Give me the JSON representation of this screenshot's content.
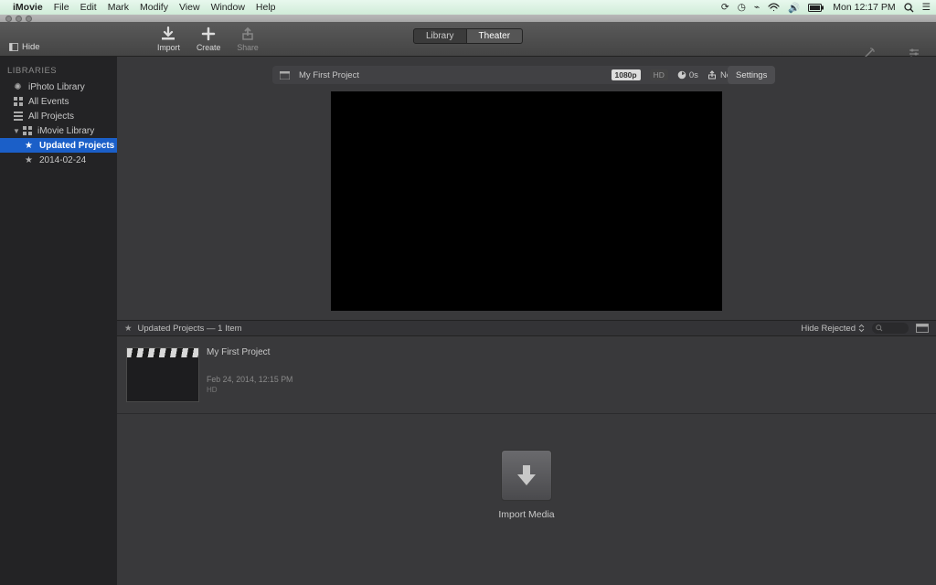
{
  "menubar": {
    "app": "iMovie",
    "items": [
      "File",
      "Edit",
      "Mark",
      "Modify",
      "View",
      "Window",
      "Help"
    ],
    "clock": "Mon 12:17 PM"
  },
  "toolbar": {
    "hide": "Hide",
    "import": "Import",
    "create": "Create",
    "share": "Share",
    "tab_library": "Library",
    "tab_theater": "Theater",
    "enhance": "Enhance",
    "adjust": "Adjust"
  },
  "sidebar": {
    "header": "LIBRARIES",
    "items": [
      {
        "label": "iPhoto Library",
        "icon": "iphoto"
      },
      {
        "label": "All Events",
        "icon": "grid"
      },
      {
        "label": "All Projects",
        "icon": "list"
      },
      {
        "label": "iMovie Library",
        "icon": "imovie",
        "disclosure": true
      },
      {
        "label": "Updated Projects",
        "icon": "star",
        "selected": true,
        "indent": true
      },
      {
        "label": "2014-02-24",
        "icon": "star",
        "indent": true
      }
    ]
  },
  "project": {
    "name": "My First Project",
    "res": "1080p",
    "hd": "HD",
    "dur": "0s",
    "share": "Not Shared",
    "settings": "Settings"
  },
  "browser": {
    "title": "Updated Projects — 1 Item",
    "hide_rejected": "Hide Rejected"
  },
  "clip": {
    "title": "My First Project",
    "date": "Feb 24, 2014, 12:15 PM",
    "res": "HD"
  },
  "import_zone": {
    "label": "Import Media"
  }
}
